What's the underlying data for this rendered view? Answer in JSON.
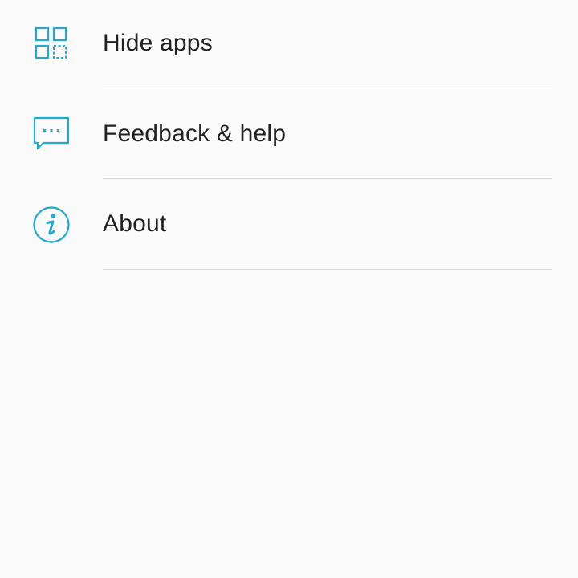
{
  "menu": {
    "items": [
      {
        "label": "Hide apps",
        "icon": "hide-apps-icon"
      },
      {
        "label": "Feedback & help",
        "icon": "feedback-chat-icon"
      },
      {
        "label": "About",
        "icon": "info-icon"
      }
    ]
  },
  "colors": {
    "accent": "#27a8cc",
    "text": "#212121",
    "divider": "#d8d8d8",
    "background": "#fafafa"
  }
}
